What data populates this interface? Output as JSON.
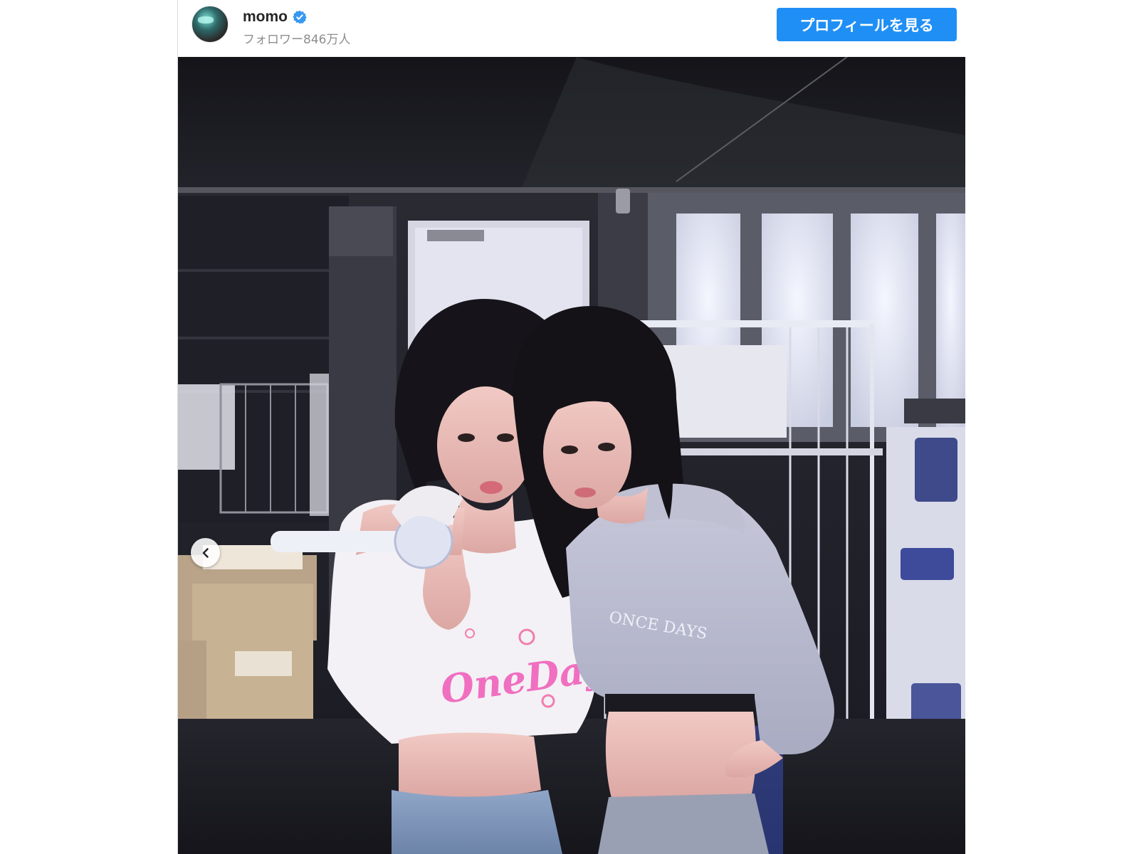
{
  "post": {
    "username": "momo",
    "followers": "フォロワー846万人",
    "profile_button_label": "プロフィールを見る",
    "verified": true
  },
  "photo": {
    "shirt_text_left": "OneDay",
    "shirt_text_right": "ONCE DAYS"
  },
  "colors": {
    "accent_blue": "#1f8ff5",
    "verified_blue": "#3897f0",
    "username": "#262626",
    "secondary_text": "#8e8e8e"
  },
  "icons": {
    "verified": "verified-badge-icon",
    "previous": "chevron-left-icon"
  }
}
